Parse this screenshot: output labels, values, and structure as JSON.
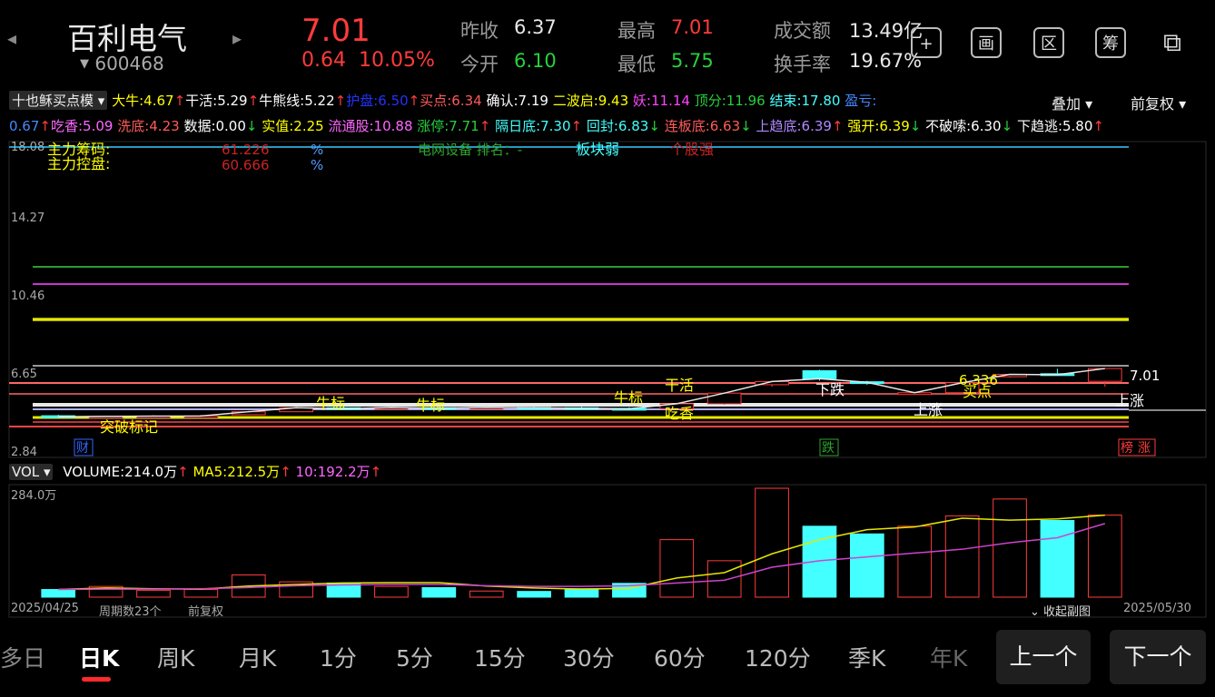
{
  "header": {
    "stock_name": "百利电气",
    "stock_code": "600468",
    "price": "7.01",
    "change": "0.64",
    "change_pct": "10.05%",
    "prev_close_label": "昨收",
    "prev_close": "6.37",
    "open_label": "今开",
    "open": "6.10",
    "high_label": "最高",
    "high": "7.01",
    "low_label": "最低",
    "low": "5.75",
    "amount_label": "成交额",
    "amount": "13.49亿",
    "turnover_label": "换手率",
    "turnover": "19.67%",
    "tools": [
      "+",
      "画",
      "区",
      "筹",
      "⧉"
    ]
  },
  "indicator": {
    "name": "十也稣买点模",
    "row1": [
      {
        "t": "大牛:4.67",
        "c": "#ffff00"
      },
      {
        "t": "↑",
        "c": "#ff3b3b"
      },
      {
        "t": "干活:5.29",
        "c": "#ffffff"
      },
      {
        "t": "↑",
        "c": "#ff3b3b"
      },
      {
        "t": "牛熊线:5.22",
        "c": "#ffffff"
      },
      {
        "t": "↑",
        "c": "#ff3b3b"
      },
      {
        "t": "护盘:6.50",
        "c": "#2233ff"
      },
      {
        "t": "↑",
        "c": "#ff3b3b"
      },
      {
        "t": "买点:6.34",
        "c": "#ff5a5a"
      },
      {
        "t": " 确认:7.19",
        "c": "#ffffff"
      },
      {
        "t": " 二波启:9.43",
        "c": "#ffff00"
      },
      {
        "t": " 妖:11.14",
        "c": "#ff44ff"
      },
      {
        "t": " 顶分:11.96",
        "c": "#26d13a"
      },
      {
        "t": " 结束:17.80",
        "c": "#44ffff"
      },
      {
        "t": " 盈亏:",
        "c": "#4488ff"
      }
    ],
    "row2": [
      {
        "t": "0.67",
        "c": "#4488ff"
      },
      {
        "t": "↑",
        "c": "#ff3b3b"
      },
      {
        "t": "吃香:5.09",
        "c": "#ff66ff"
      },
      {
        "t": " 洗底:4.23",
        "c": "#ff5a5a"
      },
      {
        "t": " 数据:0.00",
        "c": "#ffffff"
      },
      {
        "t": "↓",
        "c": "#26d13a"
      },
      {
        "t": " 实值:2.25",
        "c": "#ffff00"
      },
      {
        "t": " 流通股:10.88",
        "c": "#ff66ff"
      },
      {
        "t": " 涨停:7.71",
        "c": "#26d13a"
      },
      {
        "t": "↑",
        "c": "#ff3b3b"
      },
      {
        "t": " 隔日底:7.30",
        "c": "#44ffff"
      },
      {
        "t": "↑",
        "c": "#ff3b3b"
      },
      {
        "t": " 回封:6.83",
        "c": "#44ffff"
      },
      {
        "t": "↓",
        "c": "#26d13a"
      },
      {
        "t": " 连板底:6.63",
        "c": "#ff5a5a"
      },
      {
        "t": "↓",
        "c": "#26d13a"
      },
      {
        "t": " 上趋底:6.39",
        "c": "#b088ff"
      },
      {
        "t": "↑",
        "c": "#ff3b3b"
      },
      {
        "t": " 强开:6.39",
        "c": "#ffff00"
      },
      {
        "t": "↓",
        "c": "#26d13a"
      },
      {
        "t": " 不破嗦:6.30",
        "c": "#ffffff"
      },
      {
        "t": "↓",
        "c": "#26d13a"
      },
      {
        "t": " 下趋逃:5.80",
        "c": "#ffffff"
      },
      {
        "t": "↑",
        "c": "#ff3b3b"
      }
    ],
    "overlay_label": "叠加",
    "adjust_label": "前复权"
  },
  "main_chart": {
    "y_ticks": [
      "18.08",
      "14.27",
      "10.46",
      "6.65",
      "2.84"
    ],
    "chip_label1": "主力筹码:",
    "chip_val1": "61.226",
    "chip_pct1": "%",
    "chip_label2": "主力控盘:",
    "chip_val2": "60.666",
    "chip_pct2": "%",
    "sector_label": "电网设备 排名：-",
    "sector_weak": "板块弱",
    "stock_strong": "个股强",
    "annotations": {
      "breakout": "突破标记",
      "niu1": "牛标",
      "niu2": "牛标",
      "niu3": "牛标",
      "ganhuo": "干活",
      "chixiang": "吃香",
      "xiadie": "下跌",
      "shangzhang1": "上涨",
      "maidian": "买点",
      "val6336": "6.336",
      "last_price": "7.01",
      "shangzhang2": "上涨",
      "cai": "财",
      "die": "跌",
      "bang": "榜",
      "zhang": "涨"
    }
  },
  "volume": {
    "name": "VOL",
    "volume_text": "VOLUME:214.0万",
    "ma5_text": "MA5:212.5万",
    "ma10_text": "10:192.2万",
    "y_top": "284.0万",
    "collapse_label": "收起副图"
  },
  "footer_info": {
    "start_date": "2025/04/25",
    "period_count": "周期数23个",
    "adjust": "前复权",
    "end_date": "2025/05/30"
  },
  "tabs": [
    "多日",
    "日K",
    "周K",
    "月K",
    "1分",
    "5分",
    "15分",
    "30分",
    "60分",
    "120分",
    "季K",
    "年K"
  ],
  "active_tab": "日K",
  "prev_button": "上一个",
  "next_button": "下一个",
  "chart_data": {
    "type": "candlestick",
    "price_axis": [
      2.84,
      18.08
    ],
    "candles": [
      {
        "o": 4.65,
        "c": 4.6,
        "h": 4.7,
        "l": 4.55
      },
      {
        "o": 4.6,
        "c": 4.62,
        "h": 4.66,
        "l": 4.56
      },
      {
        "o": 4.62,
        "c": 4.63,
        "h": 4.68,
        "l": 4.58
      },
      {
        "o": 4.63,
        "c": 4.64,
        "h": 4.7,
        "l": 4.6
      },
      {
        "o": 4.7,
        "c": 4.85,
        "h": 4.9,
        "l": 4.68
      },
      {
        "o": 4.85,
        "c": 5.05,
        "h": 5.1,
        "l": 4.83
      },
      {
        "o": 5.05,
        "c": 5.0,
        "h": 5.1,
        "l": 4.95
      },
      {
        "o": 5.02,
        "c": 5.06,
        "h": 5.12,
        "l": 4.98
      },
      {
        "o": 5.06,
        "c": 5.03,
        "h": 5.1,
        "l": 5.0
      },
      {
        "o": 5.03,
        "c": 5.07,
        "h": 5.12,
        "l": 5.0
      },
      {
        "o": 5.07,
        "c": 5.05,
        "h": 5.12,
        "l": 5.01
      },
      {
        "o": 5.05,
        "c": 5.02,
        "h": 5.1,
        "l": 4.98
      },
      {
        "o": 5.02,
        "c": 5.0,
        "h": 5.08,
        "l": 4.96
      },
      {
        "o": 5.0,
        "c": 5.25,
        "h": 5.3,
        "l": 4.98
      },
      {
        "o": 5.25,
        "c": 5.78,
        "h": 5.8,
        "l": 5.2
      },
      {
        "o": 6.2,
        "c": 6.36,
        "h": 6.4,
        "l": 6.1
      },
      {
        "o": 6.9,
        "c": 6.5,
        "h": 6.95,
        "l": 6.4
      },
      {
        "o": 6.35,
        "c": 6.32,
        "h": 6.4,
        "l": 6.2
      },
      {
        "o": 5.75,
        "c": 5.8,
        "h": 5.85,
        "l": 5.7
      },
      {
        "o": 5.8,
        "c": 6.3,
        "h": 6.35,
        "l": 5.75
      },
      {
        "o": 6.6,
        "c": 6.72,
        "h": 6.74,
        "l": 6.55
      },
      {
        "o": 6.75,
        "c": 6.7,
        "h": 7.0,
        "l": 6.65
      },
      {
        "o": 6.37,
        "c": 7.01,
        "h": 7.01,
        "l": 6.1
      }
    ],
    "volume_axis_max": 284.0,
    "volumes": [
      20,
      28,
      18,
      20,
      58,
      40,
      37,
      28,
      25,
      16,
      15,
      22,
      36,
      150,
      95,
      284,
      185,
      165,
      185,
      212,
      256,
      200,
      214
    ],
    "ma5": [
      20,
      24,
      22,
      21,
      29,
      33,
      37,
      38,
      38,
      29,
      24,
      21,
      23,
      50,
      64,
      113,
      150,
      176,
      183,
      206,
      201,
      204,
      214
    ],
    "ma10": [
      20,
      21,
      21,
      22,
      25,
      30,
      32,
      33,
      33,
      30,
      28,
      28,
      30,
      37,
      44,
      78,
      95,
      105,
      115,
      125,
      142,
      155,
      192
    ]
  }
}
